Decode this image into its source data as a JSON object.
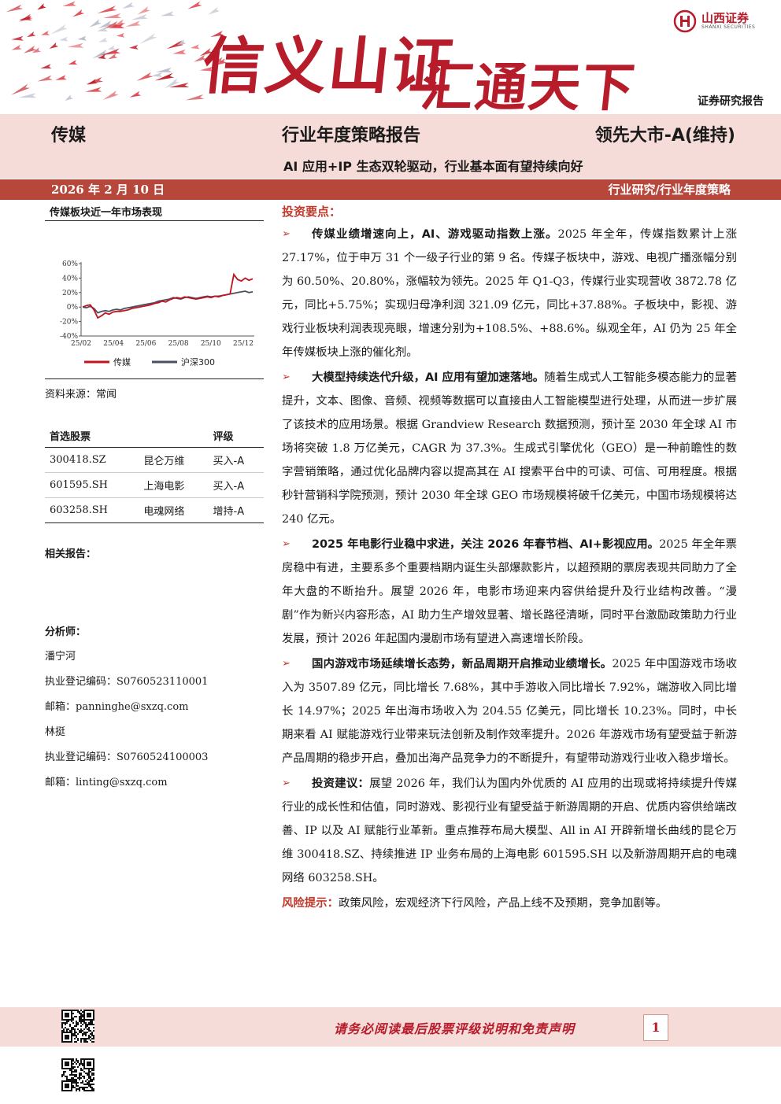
{
  "header": {
    "slogan_part1": "信义山证",
    "slogan_part2": "汇通天下",
    "company_name": "山西证券",
    "company_name_en": "SHANXI SECURITIES",
    "report_type": "证券研究报告"
  },
  "title": {
    "industry": "传媒",
    "report_title": "行业年度策略报告",
    "rating": "领先大市-A(维持)",
    "subtitle": "AI 应用+IP 生态双轮驱动，行业基本面有望持续向好"
  },
  "date_bar": {
    "date": "2026 年 2 月 10 日",
    "category": "行业研究/行业年度策略"
  },
  "chart_section": {
    "title": "传媒板块近一年市场表现",
    "source": "资料来源：常闻"
  },
  "chart_data": {
    "type": "line",
    "title": "传媒板块近一年市场表现",
    "y_ticks": [
      "60%",
      "40%",
      "20%",
      "0%",
      "-20%",
      "-40%"
    ],
    "x_ticks": [
      "25/02",
      "25/04",
      "25/06",
      "25/08",
      "25/10",
      "25/12"
    ],
    "ylim": [
      -40,
      60
    ],
    "legend_position": "bottom",
    "grid": false,
    "series": [
      {
        "name": "传媒",
        "color": "#c0141e",
        "values": [
          0,
          2,
          3,
          -4,
          -15,
          -12,
          -8,
          -10,
          -7,
          -6,
          -6,
          -5,
          -4,
          -2,
          -1,
          0,
          1,
          2,
          3,
          5,
          6,
          8,
          7,
          10,
          12,
          13,
          12,
          14,
          13,
          12,
          11,
          12,
          13,
          14,
          13,
          15,
          14,
          16,
          17,
          18,
          45,
          38,
          36,
          40,
          37,
          39
        ]
      },
      {
        "name": "沪深300",
        "color": "#4a4f63",
        "values": [
          0,
          -1,
          1,
          -2,
          -8,
          -6,
          -5,
          -6,
          -4,
          -3,
          -4,
          -2,
          -1,
          0,
          1,
          2,
          3,
          4,
          5,
          6,
          8,
          9,
          10,
          11,
          13,
          12,
          11,
          13,
          14,
          13,
          12,
          13,
          14,
          15,
          14,
          15,
          15,
          16,
          17,
          18,
          19,
          20,
          21,
          22,
          20,
          21
        ]
      }
    ]
  },
  "picks": {
    "headers": [
      "首选股票",
      "",
      "评级"
    ],
    "rows": [
      {
        "code": "300418.SZ",
        "name": "昆仑万维",
        "rating": "买入-A"
      },
      {
        "code": "601595.SH",
        "name": "上海电影",
        "rating": "买入-A"
      },
      {
        "code": "603258.SH",
        "name": "电魂网络",
        "rating": "增持-A"
      }
    ]
  },
  "related_reports_label": "相关报告：",
  "analysts": {
    "label": "分析师：",
    "list": [
      {
        "name": "潘宁河",
        "reg_label": "执业登记编码：",
        "reg_code": "S0760523110001",
        "email_label": "邮箱：",
        "email": "panninghe@sxzq.com"
      },
      {
        "name": "林挺",
        "reg_label": "执业登记编码：",
        "reg_code": "S0760524100003",
        "email_label": "邮箱：",
        "email": "linting@sxzq.com"
      }
    ]
  },
  "key_points": {
    "title": "投资要点：",
    "bullets": [
      {
        "lead": "传媒业绩增速向上，AI、游戏驱动指数上涨。",
        "text": "2025 年全年，传媒指数累计上涨 27.17%，位于申万 31 个一级子行业的第 9 名。传媒子板块中，游戏、电视广播涨幅分别为 60.50%、20.80%，涨幅较为领先。2025 年 Q1-Q3，传媒行业实现营收 3872.78 亿元，同比+5.75%；实现归母净利润 321.09 亿元，同比+37.88%。子板块中，影视、游戏行业板块利润表现亮眼，增速分别为+108.5%、+88.6%。纵观全年，AI 仍为 25 年全年传媒板块上涨的催化剂。"
      },
      {
        "lead": "大模型持续迭代升级，AI 应用有望加速落地。",
        "text": "随着生成式人工智能多模态能力的显著提升，文本、图像、音频、视频等数据可以直接由人工智能模型进行处理，从而进一步扩展了该技术的应用场景。根据 Grandview Research 数据预测，预计至 2030 年全球 AI 市场将突破 1.8 万亿美元，CAGR 为 37.3%。生成式引擎优化（GEO）是一种前瞻性的数字营销策略，通过优化品牌内容以提高其在 AI 搜索平台中的可读、可信、可用程度。根据秒针营销科学院预测，预计 2030  年全球 GEO 市场规模将破千亿美元，中国市场规模将达 240 亿元。"
      },
      {
        "lead": "2025 年电影行业稳中求进，关注 2026 年春节档、AI+影视应用。",
        "text": "2025 年全年票房稳中有进，主要系多个重要档期内诞生头部爆款影片，以超预期的票房表现共同助力了全年大盘的不断抬升。展望 2026 年，电影市场迎来内容供给提升及行业结构改善。“漫剧”作为新兴内容形态，AI 助力生产增效显著、增长路径清晰，同时平台激励政策助力行业发展，预计 2026 年起国内漫剧市场有望进入高速增长阶段。"
      },
      {
        "lead": "国内游戏市场延续增长态势，新品周期开启推动业绩增长。",
        "text": "2025 年中国游戏市场收入为 3507.89 亿元，同比增长 7.68%，其中手游收入同比增长 7.92%，端游收入同比增长 14.97%；2025 年出海市场收入为 204.55 亿美元，同比增长 10.23%。同时，中长期来看 AI 赋能游戏行业带来玩法创新及制作效率提升。2026 年游戏市场有望受益于新游产品周期的稳步开启，叠加出海产品竞争力的不断提升，有望带动游戏行业收入稳步增长。"
      },
      {
        "lead": "投资建议：",
        "text": "展望 2026 年，我们认为国内外优质的 AI 应用的出现或将持续提升传媒行业的成长性和估值，同时游戏、影视行业有望受益于新游周期的开启、优质内容供给端改善、IP 以及 AI 赋能行业革新。重点推荐布局大模型、All in AI 开辟新增长曲线的昆仑万维 300418.SZ、持续推进 IP 业务布局的上海电影 601595.SH 以及新游周期开启的电魂网络 603258.SH。"
      }
    ],
    "risk_label": "风险提示：",
    "risk_text": "政策风险，宏观经济下行风险，产品上线不及预期，竞争加剧等。"
  },
  "footer": {
    "disclaimer": "请务必阅读最后股票评级说明和免责声明",
    "page_number": "1"
  }
}
